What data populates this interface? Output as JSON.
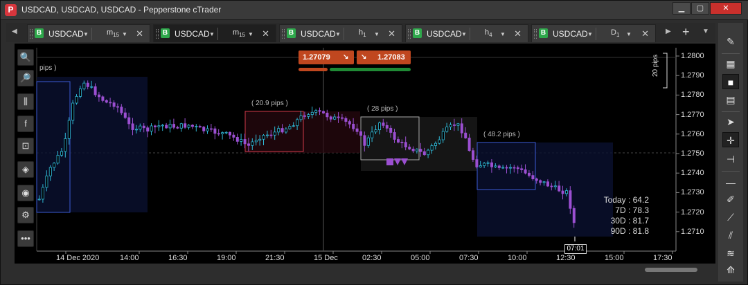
{
  "window": {
    "title": "USDCAD, USDCAD, USDCAD - Pepperstone cTrader",
    "logo": "P",
    "min": "▁",
    "max": "▢",
    "close": "✕"
  },
  "tabs": [
    {
      "badge": "B",
      "symbol": "USDCAD",
      "tf_main": "m",
      "tf_sub": "15",
      "close": "✕"
    },
    {
      "badge": "B",
      "symbol": "USDCAD",
      "tf_main": "m",
      "tf_sub": "15",
      "close": "✕"
    },
    {
      "badge": "B",
      "symbol": "USDCAD",
      "tf_main": "h",
      "tf_sub": "1",
      "close": "✕"
    },
    {
      "badge": "B",
      "symbol": "USDCAD",
      "tf_main": "h",
      "tf_sub": "4",
      "close": "✕"
    },
    {
      "badge": "B",
      "symbol": "USDCAD",
      "tf_main": "D",
      "tf_sub": "1",
      "close": "✕"
    }
  ],
  "tabbar": {
    "prev": "◀",
    "next": "▶",
    "add": "+",
    "menu": "▼"
  },
  "order": {
    "sell_price": "1.27079",
    "buy_price": "1.27083",
    "sell_arrow": "↘",
    "buy_arrow": "↘"
  },
  "y_axis": [
    "1.2800",
    "1.2790",
    "1.2780",
    "1.2770",
    "1.2760",
    "1.2750",
    "1.2740",
    "1.2730",
    "1.2720",
    "1.2710"
  ],
  "x_axis": [
    "14 Dec 2020",
    "14:00",
    "16:30",
    "19:00",
    "21:30",
    "15 Dec",
    "02:30",
    "05:00",
    "07:30",
    "10:00",
    "12:30",
    "15:00",
    "17:30"
  ],
  "pips": {
    "left": "pips )",
    "box1": "( 20.9 pips )",
    "box2": "( 28 pips )",
    "box3": "( 48.2 pips )",
    "scale": "20 pips"
  },
  "stats": {
    "today": "Today : 64.2",
    "d7": "7D : 78.3",
    "d30": "30D : 81.7",
    "d90": "90D : 81.8"
  },
  "current_time": "07:01",
  "colors": {
    "bull": "#2fb8d6",
    "bear": "#9b4fd1",
    "sell": "#c0471f",
    "buy": "#1f8a35",
    "box_blue": "#3b5bd6",
    "box_red": "#d03a4a",
    "box_gray": "#aaaaaa"
  },
  "icons": {
    "left": [
      "zoom-in-icon",
      "zoom-out-icon",
      "candles-icon",
      "facebook-icon",
      "robot-icon",
      "layers-icon",
      "eye-icon",
      "chart-settings-icon",
      "more-icon"
    ],
    "right": [
      "edit-icon",
      "grid-icon",
      "single-window-icon",
      "split-window-icon",
      "cursor-icon",
      "crosshair-icon",
      "measure-icon",
      "hline-icon",
      "pencil-icon",
      "fib-icon",
      "trendlines-icon",
      "channel-icon",
      "fib-fan-icon"
    ]
  }
}
